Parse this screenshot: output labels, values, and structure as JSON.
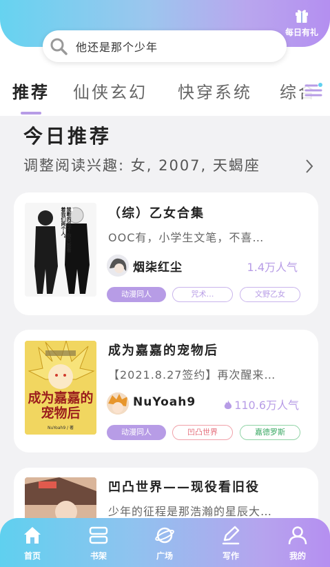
{
  "header": {
    "daily_gift_label": "每日有礼",
    "search_text": "他还是那个少年"
  },
  "tabs": [
    "推荐",
    "仙侠玄幻",
    "快穿系统",
    "综合"
  ],
  "section": {
    "title": "今日推荐",
    "subtitle": "调整阅读兴趣: 女, 2007, 天蝎座"
  },
  "books": [
    {
      "title": "（综）乙女合集",
      "desc": "OOC有，小学生文笔，不喜…",
      "author": "烟柒红尘",
      "popularity": "1.4万人气",
      "hot": false,
      "tags": [
        "动漫同人",
        "咒术…",
        "文野乙女"
      ],
      "tag_styles": [
        "fill",
        "purple",
        "purple"
      ],
      "cover_text": "禁断的双子·你只能看着我们两个人。"
    },
    {
      "title": "成为嘉嘉的宠物后",
      "desc": "【2021.8.27签约】再次醒来…",
      "author": "NuYoah9",
      "popularity": "110.6万人气",
      "hot": true,
      "tags": [
        "动漫同人",
        "凹凸世界",
        "嘉德罗斯"
      ],
      "tag_styles": [
        "fill",
        "red",
        "green"
      ],
      "cover_text": "成为嘉嘉的宠物后",
      "cover_author": "NuYoah9 / 著"
    },
    {
      "title": "凹凸世界——现役看旧役",
      "desc": "少年的征程是那浩瀚的星辰大…"
    }
  ],
  "bottom_nav": [
    {
      "label": "首页",
      "icon": "home-icon"
    },
    {
      "label": "书架",
      "icon": "bookshelf-icon"
    },
    {
      "label": "广场",
      "icon": "planet-icon"
    },
    {
      "label": "写作",
      "icon": "pen-icon"
    },
    {
      "label": "我的",
      "icon": "user-icon"
    }
  ],
  "colors": {
    "accent": "#b79ce6",
    "gradient_start": "#66d3f0",
    "gradient_end": "#b48ff0"
  }
}
